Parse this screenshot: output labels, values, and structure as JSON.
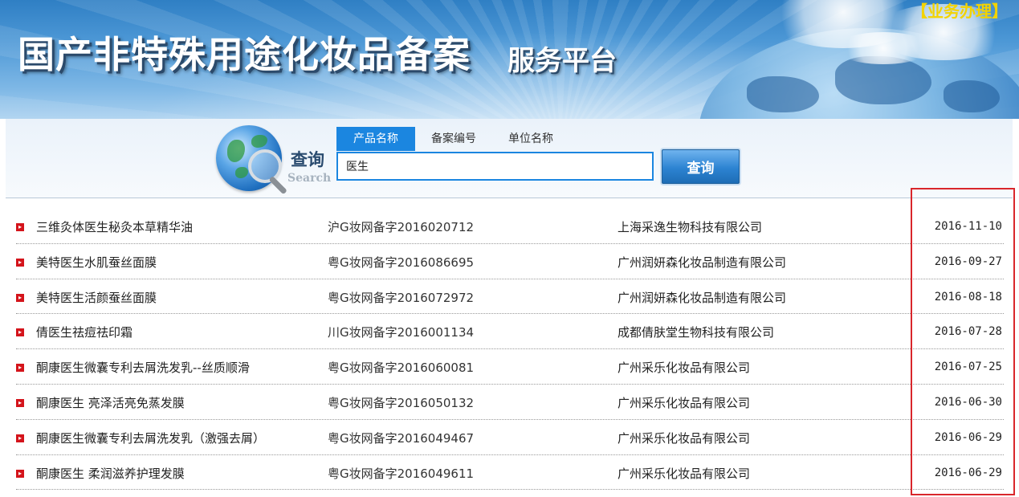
{
  "header": {
    "title": "国产非特殊用途化妆品备案",
    "subtitle": "服务平台",
    "business_link": "【业务办理】"
  },
  "search": {
    "logo_text": "查询",
    "logo_text_en": "Search",
    "tabs": [
      {
        "label": "产品名称",
        "active": true
      },
      {
        "label": "备案编号",
        "active": false
      },
      {
        "label": "单位名称",
        "active": false
      }
    ],
    "input_value": "医生",
    "button_label": "查询"
  },
  "results": [
    {
      "name": "三维灸体医生秘灸本草精华油",
      "reg_no": "沪G妆网备字2016020712",
      "company": "上海采逸生物科技有限公司",
      "date": "2016-11-10"
    },
    {
      "name": "美特医生水肌蚕丝面膜",
      "reg_no": "粤G妆网备字2016086695",
      "company": "广州润妍森化妆品制造有限公司",
      "date": "2016-09-27"
    },
    {
      "name": "美特医生活颜蚕丝面膜",
      "reg_no": "粤G妆网备字2016072972",
      "company": "广州润妍森化妆品制造有限公司",
      "date": "2016-08-18"
    },
    {
      "name": "倩医生祛痘祛印霜",
      "reg_no": "川G妆网备字2016001134",
      "company": "成都倩肤堂生物科技有限公司",
      "date": "2016-07-28"
    },
    {
      "name": "酮康医生微囊专利去屑洗发乳--丝质顺滑",
      "reg_no": "粤G妆网备字2016060081",
      "company": "广州采乐化妆品有限公司",
      "date": "2016-07-25"
    },
    {
      "name": "酮康医生 亮泽活亮免蒸发膜",
      "reg_no": "粤G妆网备字2016050132",
      "company": "广州采乐化妆品有限公司",
      "date": "2016-06-30"
    },
    {
      "name": "酮康医生微囊专利去屑洗发乳（激强去屑）",
      "reg_no": "粤G妆网备字2016049467",
      "company": "广州采乐化妆品有限公司",
      "date": "2016-06-29"
    },
    {
      "name": "酮康医生 柔润滋养护理发膜",
      "reg_no": "粤G妆网备字2016049611",
      "company": "广州采乐化妆品有限公司",
      "date": "2016-06-29"
    }
  ],
  "colors": {
    "accent": "#1b86e0",
    "bullet": "#d4141b",
    "highlight_border": "#d9262b",
    "business_link": "#f3d300"
  }
}
